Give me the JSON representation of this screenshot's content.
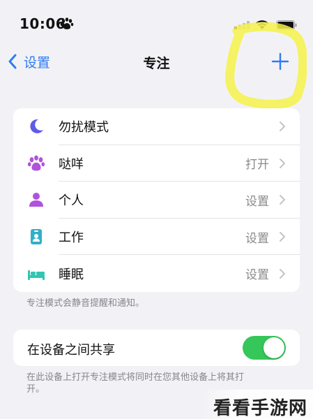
{
  "status_bar": {
    "time": "10:06"
  },
  "nav": {
    "back_label": "设置",
    "title": "专注"
  },
  "focus_modes": [
    {
      "label": "勿扰模式",
      "value": "",
      "icon": "moon-icon",
      "color": "#5e5ce6"
    },
    {
      "label": "哒咩",
      "value": "打开",
      "icon": "paw-icon",
      "color": "#af52de"
    },
    {
      "label": "个人",
      "value": "设置",
      "icon": "person-icon",
      "color": "#af52de"
    },
    {
      "label": "工作",
      "value": "设置",
      "icon": "id-badge-icon",
      "color": "#30b0c7"
    },
    {
      "label": "睡眠",
      "value": "设置",
      "icon": "bed-icon",
      "color": "#30c7b2"
    }
  ],
  "modes_footnote": "专注模式会静音提醒和通知。",
  "share": {
    "label": "在设备之间共享",
    "enabled": true,
    "footnote": "在此设备上打开专注模式将同时在您其他设备上将其打开。"
  },
  "watermark": "看看手游网",
  "colors": {
    "accent": "#2f7bf6",
    "toggle_on": "#35c759",
    "highlight": "#f6f24a",
    "background": "#f2f2f6"
  }
}
